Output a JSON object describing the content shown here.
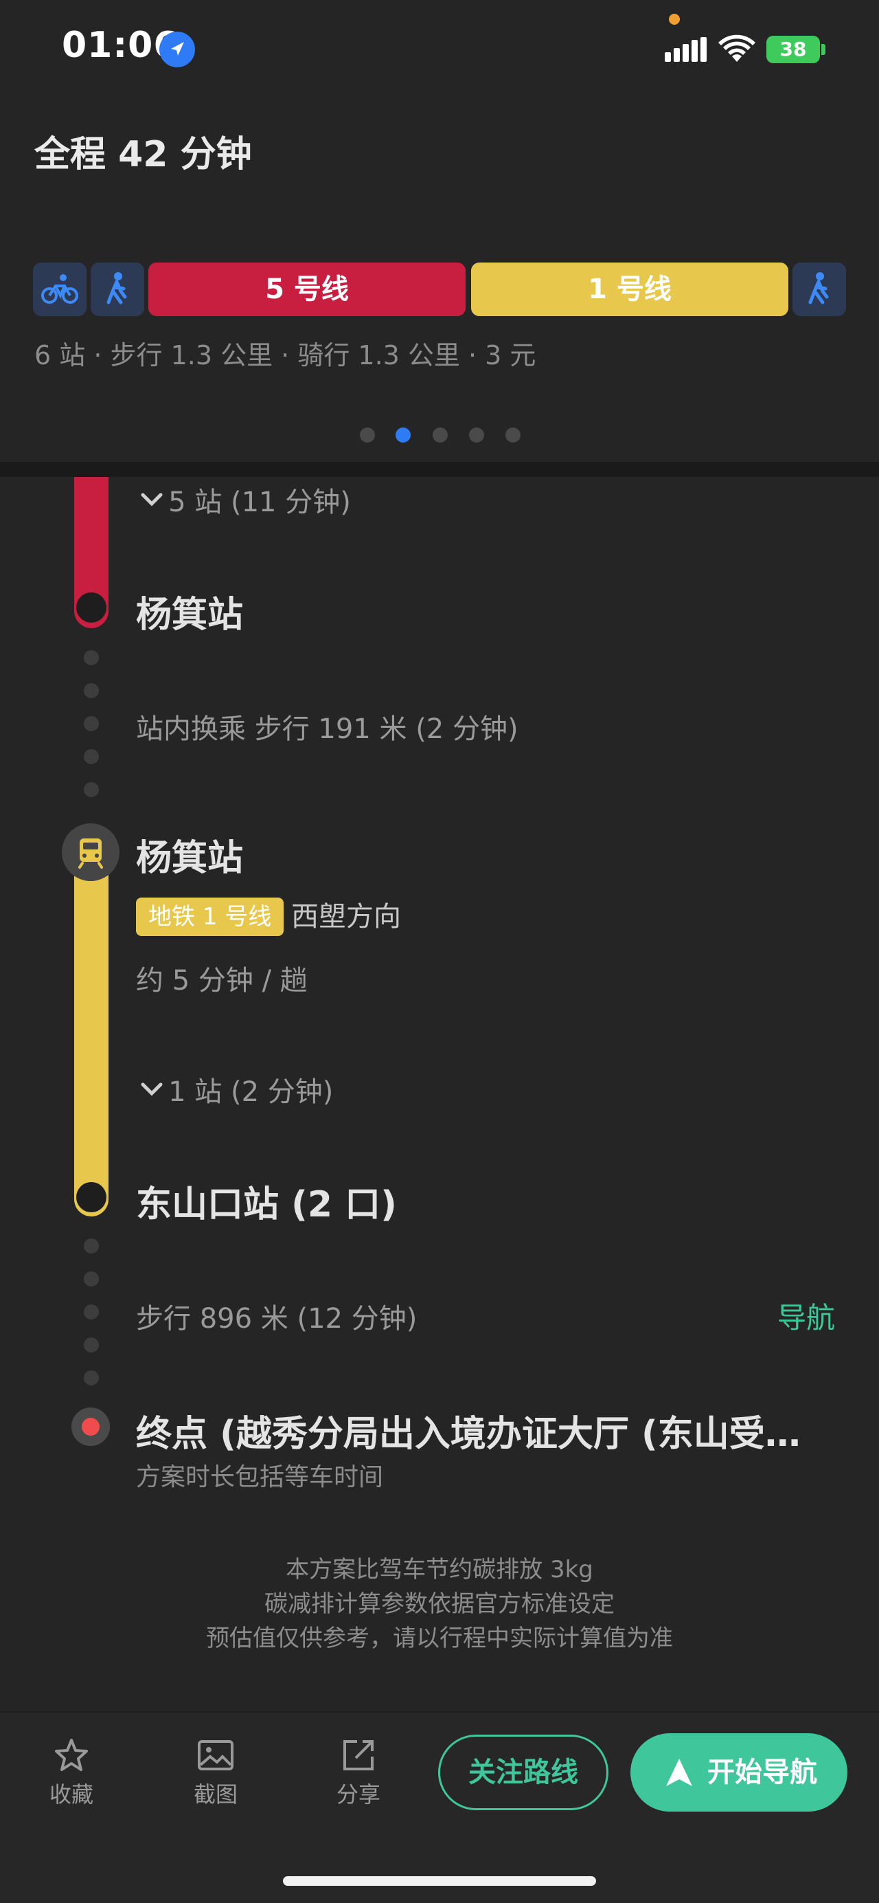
{
  "status_bar": {
    "time": "01:06",
    "battery": "38"
  },
  "header": {
    "title": "全程 42 分钟"
  },
  "route_bar": {
    "segments": [
      {
        "type": "bike",
        "icon": "bike-icon"
      },
      {
        "type": "walk",
        "icon": "walk-icon"
      },
      {
        "type": "line",
        "label": "5 号线",
        "color": "#c81e40"
      },
      {
        "type": "line",
        "label": "1 号线",
        "color": "#e8c84c"
      },
      {
        "type": "walk",
        "icon": "walk-icon"
      }
    ],
    "summary": "6 站 · 步行 1.3 公里 · 骑行 1.3 公里 · 3 元"
  },
  "pager": {
    "count": 5,
    "active_index": 1
  },
  "timeline": {
    "line5_expand": "5 站 (11 分钟)",
    "station_yangji_1": "杨箕站",
    "transfer_text": "站内换乘 步行 191 米 (2 分钟)",
    "station_yangji_2": "杨箕站",
    "line1_badge": "地铁 1 号线",
    "line1_direction": "西塱方向",
    "line1_frequency": "约 5 分钟 / 趟",
    "line1_expand": "1 站 (2 分钟)",
    "station_dongshankou": "东山口站 (2 口)",
    "walk_text": "步行 896 米 (12 分钟)",
    "walk_nav_link": "导航",
    "end_title": "终点 (越秀分局出入境办证大厅 (东山受…",
    "end_subtitle": "方案时长包括等车时间"
  },
  "notes": [
    "本方案比驾车节约碳排放 3kg",
    "碳减排计算参数依据官方标准设定",
    "预估值仅供参考，请以行程中实际计算值为准"
  ],
  "bottom_bar": {
    "favorite_label": "收藏",
    "screenshot_label": "截图",
    "share_label": "分享",
    "follow_route_label": "关注路线",
    "start_nav_label": "开始导航"
  },
  "colors": {
    "accent_green": "#3fc69a",
    "line5_red": "#c81e40",
    "line1_yellow": "#e8c84c",
    "blue": "#2f7bf5"
  }
}
